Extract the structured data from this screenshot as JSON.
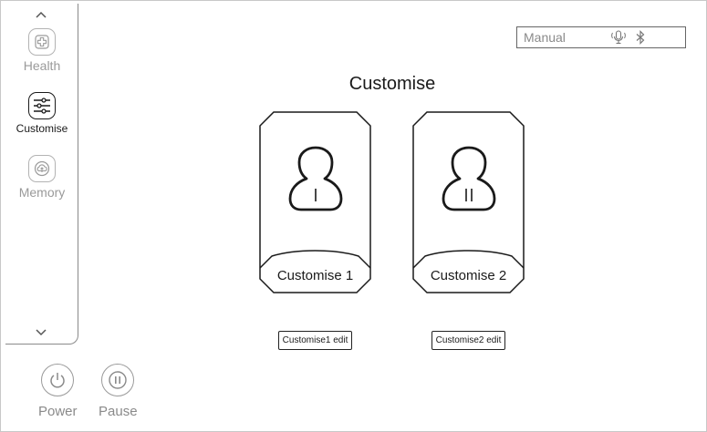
{
  "sidebar": {
    "items": [
      {
        "label": "Health",
        "icon": "plus-cross-icon"
      },
      {
        "label": "Customise",
        "icon": "sliders-icon"
      },
      {
        "label": "Memory",
        "icon": "cloud-upload-icon"
      }
    ]
  },
  "controls": {
    "power_label": "Power",
    "pause_label": "Pause"
  },
  "status": {
    "mode_label": "Manual",
    "icons": [
      "voice-icon",
      "bluetooth-icon"
    ]
  },
  "page": {
    "title": "Customise"
  },
  "cards": [
    {
      "label": "Customise 1",
      "roman": "I",
      "edit_label": "Customise1 edit"
    },
    {
      "label": "Customise 2",
      "roman": "II",
      "edit_label": "Customise2 edit"
    }
  ],
  "colors": {
    "active": "#1a1a1a",
    "inactive": "#9a9a9a"
  }
}
